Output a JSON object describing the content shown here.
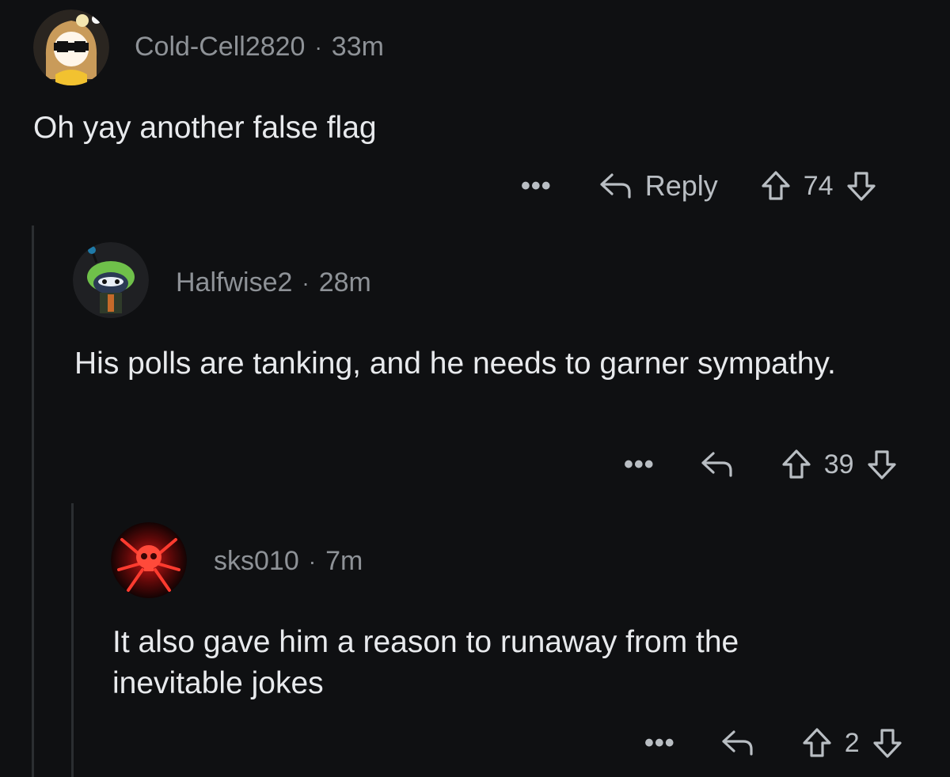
{
  "comments": [
    {
      "username": "Cold-Cell2820",
      "time": "33m",
      "text": "Oh yay another false flag",
      "reply_label": "Reply",
      "score": "74",
      "avatar": "anime-girl-sunglasses-avatar"
    },
    {
      "username": "Halfwise2",
      "time": "28m",
      "text": "His polls are tanking, and he needs to garner sympathy.",
      "score": "39",
      "avatar": "snoo-frog-hat-avatar"
    },
    {
      "username": "sks010",
      "time": "7m",
      "text": "It also gave him a reason to runaway from the inevitable jokes",
      "score": "2",
      "avatar": "red-skull-avatar"
    }
  ],
  "separator": "·",
  "more_glyph": "•••",
  "colors": {
    "background": "#0f1012",
    "meta_text": "#8e9297",
    "body_text": "#e8eaed",
    "thread_line": "#2b2e31"
  }
}
